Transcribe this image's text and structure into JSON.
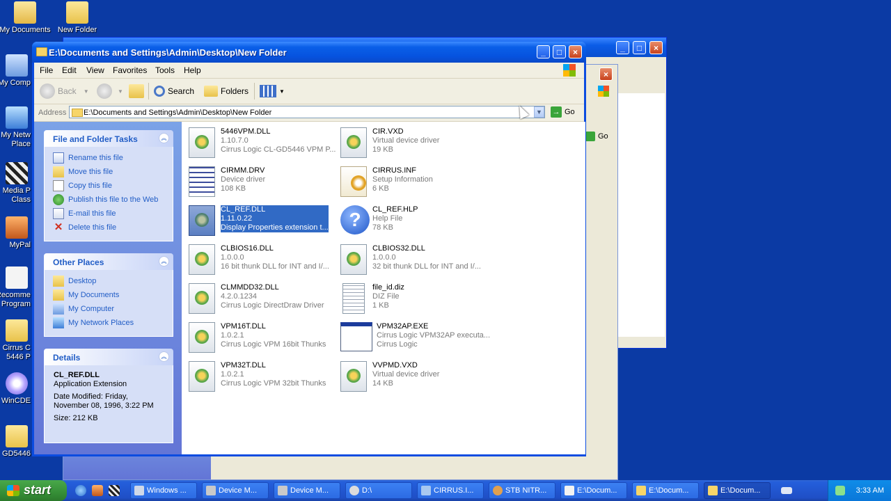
{
  "desktop": {
    "icons": [
      {
        "label": "My Documents"
      },
      {
        "label": "New Folder"
      },
      {
        "label": "My Comp"
      },
      {
        "label": "My Netw Place"
      },
      {
        "label": "Media P Class"
      },
      {
        "label": "MyPal"
      },
      {
        "label": "Recomme Program"
      },
      {
        "label": "Cirrus C 5446 P"
      },
      {
        "label": "WinCDE"
      },
      {
        "label": "GD5446"
      }
    ]
  },
  "background_window": {
    "go_label": "Go"
  },
  "window": {
    "title": "E:\\Documents and Settings\\Admin\\Desktop\\New Folder",
    "menu": [
      "File",
      "Edit",
      "View",
      "Favorites",
      "Tools",
      "Help"
    ],
    "toolbar": {
      "back": "Back",
      "search": "Search",
      "folders": "Folders"
    },
    "address": {
      "label": "Address",
      "value": "E:\\Documents and Settings\\Admin\\Desktop\\New Folder",
      "go": "Go"
    }
  },
  "task_pane": {
    "file_tasks": {
      "title": "File and Folder Tasks",
      "items": [
        "Rename this file",
        "Move this file",
        "Copy this file",
        "Publish this file to the Web",
        "E-mail this file",
        "Delete this file"
      ]
    },
    "other_places": {
      "title": "Other Places",
      "items": [
        "Desktop",
        "My Documents",
        "My Computer",
        "My Network Places"
      ]
    },
    "details": {
      "title": "Details",
      "name": "CL_REF.DLL",
      "type": "Application Extension",
      "modified_line1": "Date Modified: Friday,",
      "modified_line2": "November 08, 1996, 3:22 PM",
      "size": "Size: 212 KB"
    }
  },
  "files": [
    {
      "name": "5446VPM.DLL",
      "line2": "1.10.7.0",
      "line3": "Cirrus Logic CL-GD5446 VPM P...",
      "icon": "dll-gear-icon"
    },
    {
      "name": "CIR.VXD",
      "line2": "Virtual device driver",
      "line3": "19 KB",
      "icon": "dll-gear-icon"
    },
    {
      "name": "CIRMM.DRV",
      "line2": "Device driver",
      "line3": "108 KB",
      "icon": "driver-icon"
    },
    {
      "name": "CIRRUS.INF",
      "line2": "Setup Information",
      "line3": "6 KB",
      "icon": "inf-gear-icon"
    },
    {
      "name": "CL_REF.DLL",
      "line2": "1.11.0.22",
      "line3": "Display Properties extension t...",
      "icon": "dll-gear-icon",
      "selected": true
    },
    {
      "name": "CL_REF.HLP",
      "line2": "Help File",
      "line3": "78 KB",
      "icon": "help-icon"
    },
    {
      "name": "CLBIOS16.DLL",
      "line2": "1.0.0.0",
      "line3": "16 bit thunk DLL for INT and I/...",
      "icon": "dll-gear-icon"
    },
    {
      "name": "CLBIOS32.DLL",
      "line2": "1.0.0.0",
      "line3": "32 bit thunk DLL for INT and I/...",
      "icon": "dll-gear-icon"
    },
    {
      "name": "CLMMDD32.DLL",
      "line2": "4.2.0.1234",
      "line3": "Cirrus Logic DirectDraw Driver",
      "icon": "dll-gear-icon"
    },
    {
      "name": "file_id.diz",
      "line2": "DIZ File",
      "line3": "1 KB",
      "icon": "text-file-icon"
    },
    {
      "name": "VPM16T.DLL",
      "line2": "1.0.2.1",
      "line3": "Cirrus Logic VPM 16bit Thunks",
      "icon": "dll-gear-icon"
    },
    {
      "name": "VPM32AP.EXE",
      "line2": "Cirrus Logic VPM32AP executa...",
      "line3": "Cirrus Logic",
      "icon": "exe-window-icon"
    },
    {
      "name": "VPM32T.DLL",
      "line2": "1.0.2.1",
      "line3": "Cirrus Logic VPM 32bit Thunks",
      "icon": "dll-gear-icon"
    },
    {
      "name": "VVPMD.VXD",
      "line2": "Virtual device driver",
      "line3": "14 KB",
      "icon": "dll-gear-icon"
    }
  ],
  "taskbar": {
    "start": "start",
    "tasks": [
      "Windows ...",
      "Device M...",
      "Device M...",
      "D:\\",
      "CIRRUS.I...",
      "STB NITR...",
      "E:\\Docum...",
      "E:\\Docum...",
      "E:\\Docum..."
    ],
    "clock": "3:33 AM"
  }
}
